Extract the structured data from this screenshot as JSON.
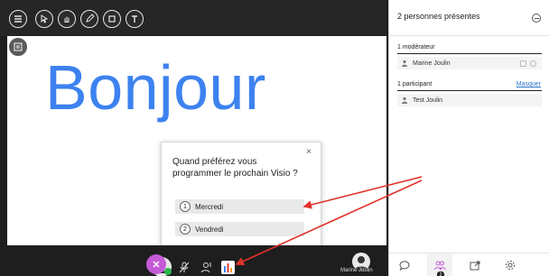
{
  "whiteboard": {
    "text": "Bonjour"
  },
  "poll": {
    "close_label": "×",
    "question": "Quand préférez vous programmer le prochain Visio ?",
    "options": [
      {
        "number": "1",
        "label": "Mercredi"
      },
      {
        "number": "2",
        "label": "Vendredi"
      }
    ]
  },
  "bottombar": {
    "presenter_name": "Marine Joulin"
  },
  "panel": {
    "title": "2 personnes présentes",
    "moderators_title": "1 modérateur",
    "moderators": [
      {
        "name": "Marine Joulin"
      }
    ],
    "participants_title": "1 participant",
    "hide_label": "Masquer",
    "participants": [
      {
        "name": "Test Joulin"
      }
    ],
    "attendees_badge": "2"
  },
  "colors": {
    "accent_blue": "#3d82f0",
    "annotation_red": "#e2332a",
    "close_purple": "#c55ad6"
  }
}
